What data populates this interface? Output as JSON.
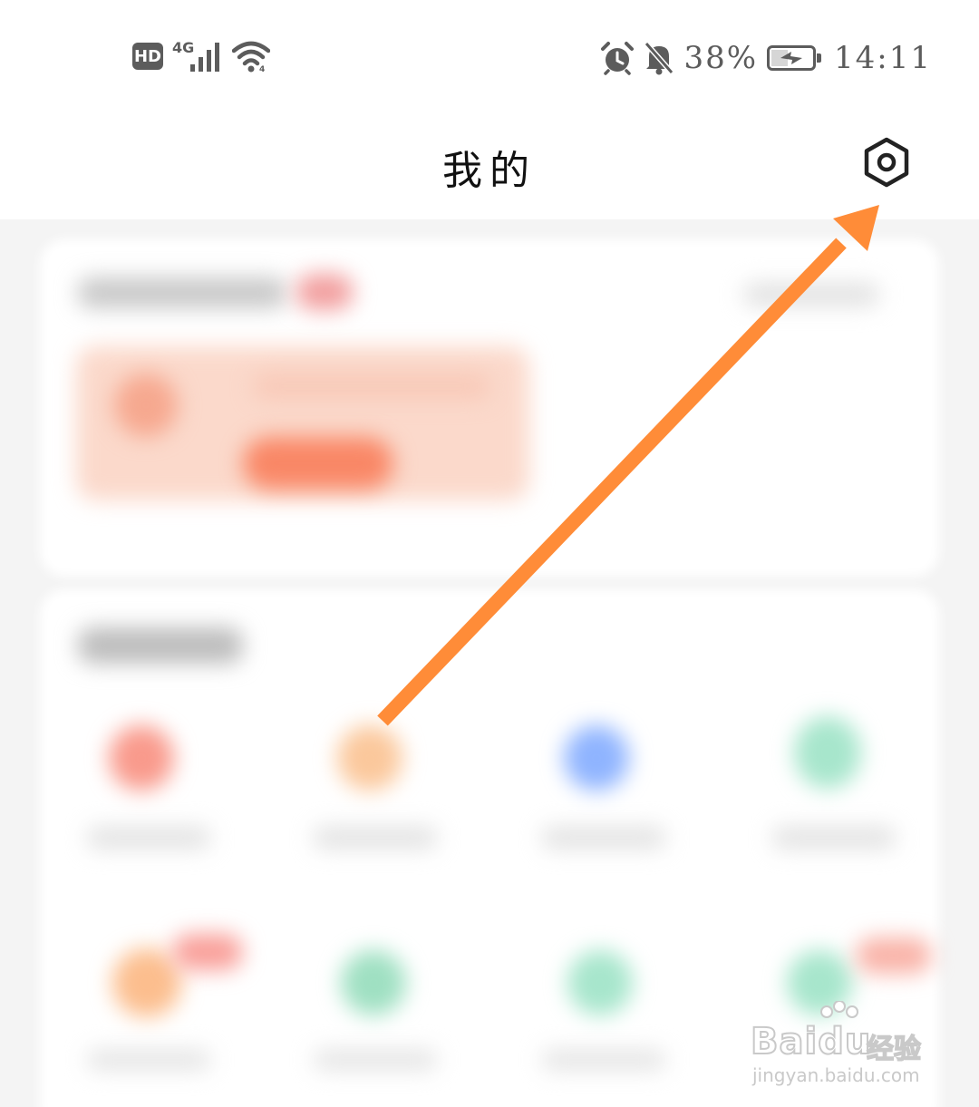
{
  "status_bar": {
    "hd_badge": "HD",
    "network": "4G",
    "battery_percent": "38%",
    "battery_level": 0.38,
    "time": "14:11",
    "icons": [
      "hd-icon",
      "signal-icon",
      "wifi-icon",
      "alarm-icon",
      "mute-bell-icon",
      "battery-charging-icon"
    ]
  },
  "header": {
    "title": "我的",
    "settings_icon": "settings-hexagon-icon"
  },
  "annotation": {
    "arrow_color": "#FF8C38"
  },
  "watermark": {
    "brand": "Baidu",
    "product": "经验",
    "url": "jingyan.baidu.com"
  }
}
